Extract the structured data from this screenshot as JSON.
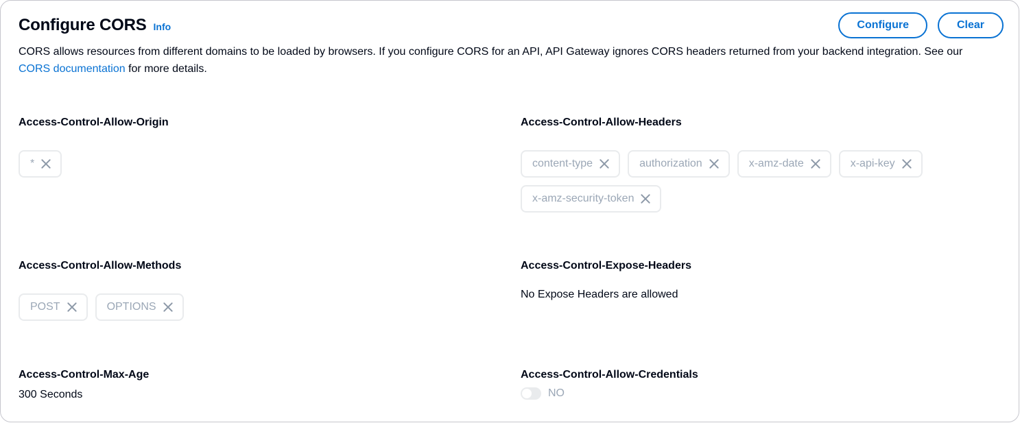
{
  "header": {
    "title": "Configure CORS",
    "info_label": "Info"
  },
  "actions": {
    "configure_label": "Configure",
    "clear_label": "Clear"
  },
  "description": {
    "text_before": "CORS allows resources from different domains to be loaded by browsers. If you configure CORS for an API, API Gateway ignores CORS headers returned from your backend integration. See our ",
    "link_text": "CORS documentation",
    "text_after": " for more details."
  },
  "allow_origin": {
    "label": "Access-Control-Allow-Origin",
    "tokens": [
      "*"
    ]
  },
  "allow_headers": {
    "label": "Access-Control-Allow-Headers",
    "tokens": [
      "content-type",
      "authorization",
      "x-amz-date",
      "x-api-key",
      "x-amz-security-token"
    ]
  },
  "allow_methods": {
    "label": "Access-Control-Allow-Methods",
    "tokens": [
      "POST",
      "OPTIONS"
    ]
  },
  "expose_headers": {
    "label": "Access-Control-Expose-Headers",
    "value": "No Expose Headers are allowed"
  },
  "max_age": {
    "label": "Access-Control-Max-Age",
    "value": "300 Seconds"
  },
  "allow_credentials": {
    "label": "Access-Control-Allow-Credentials",
    "toggle_on": false,
    "toggle_label": "NO"
  },
  "colors": {
    "accent": "#0972d3",
    "text": "#000716",
    "disabled_text": "#9ba7b6",
    "token_border": "#e9ebed"
  },
  "icons": {
    "token_remove": "close-icon"
  }
}
